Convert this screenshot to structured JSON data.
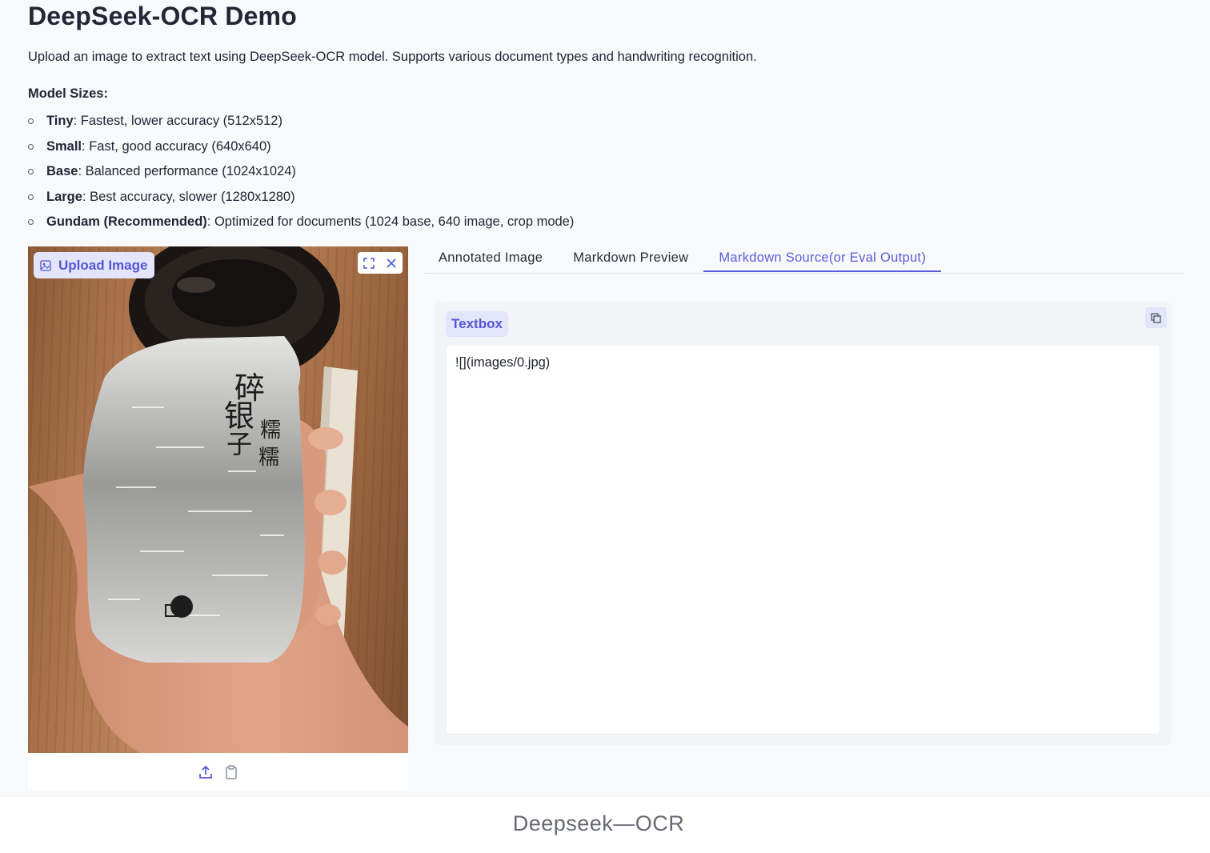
{
  "header": {
    "title": "DeepSeek-OCR Demo",
    "description": "Upload an image to extract text using DeepSeek-OCR model. Supports various document types and handwriting recognition."
  },
  "model_sizes": {
    "heading": "Model Sizes:",
    "items": [
      {
        "name": "Tiny",
        "detail": ": Fastest, lower accuracy (512x512)"
      },
      {
        "name": "Small",
        "detail": ": Fast, good accuracy (640x640)"
      },
      {
        "name": "Base",
        "detail": ": Balanced performance (1024x1024)"
      },
      {
        "name": "Large",
        "detail": ": Best accuracy, slower (1280x1280)"
      },
      {
        "name": "Gundam (Recommended)",
        "detail": ": Optimized for documents (1024 base, 640 image, crop mode)"
      }
    ]
  },
  "image_panel": {
    "label": "Upload Image",
    "icons": [
      "image-icon",
      "fullscreen-icon",
      "close-icon",
      "upload-icon",
      "clipboard-icon"
    ],
    "photo_text": [
      "碎",
      "银",
      "子",
      "糯",
      "糯"
    ]
  },
  "tabs": [
    {
      "label": "Annotated Image",
      "active": false
    },
    {
      "label": "Markdown Preview",
      "active": false
    },
    {
      "label": "Markdown Source(or Eval Output)",
      "active": true
    }
  ],
  "textbox": {
    "label": "Textbox",
    "value": "![](images/0.jpg)",
    "copy_icon": "copy-icon"
  },
  "footer": {
    "caption": "Deepseek—OCR"
  },
  "colors": {
    "accent": "#5a5cd9",
    "label_bg": "#e3e5fb",
    "page_bg": "#f8f9fb"
  }
}
